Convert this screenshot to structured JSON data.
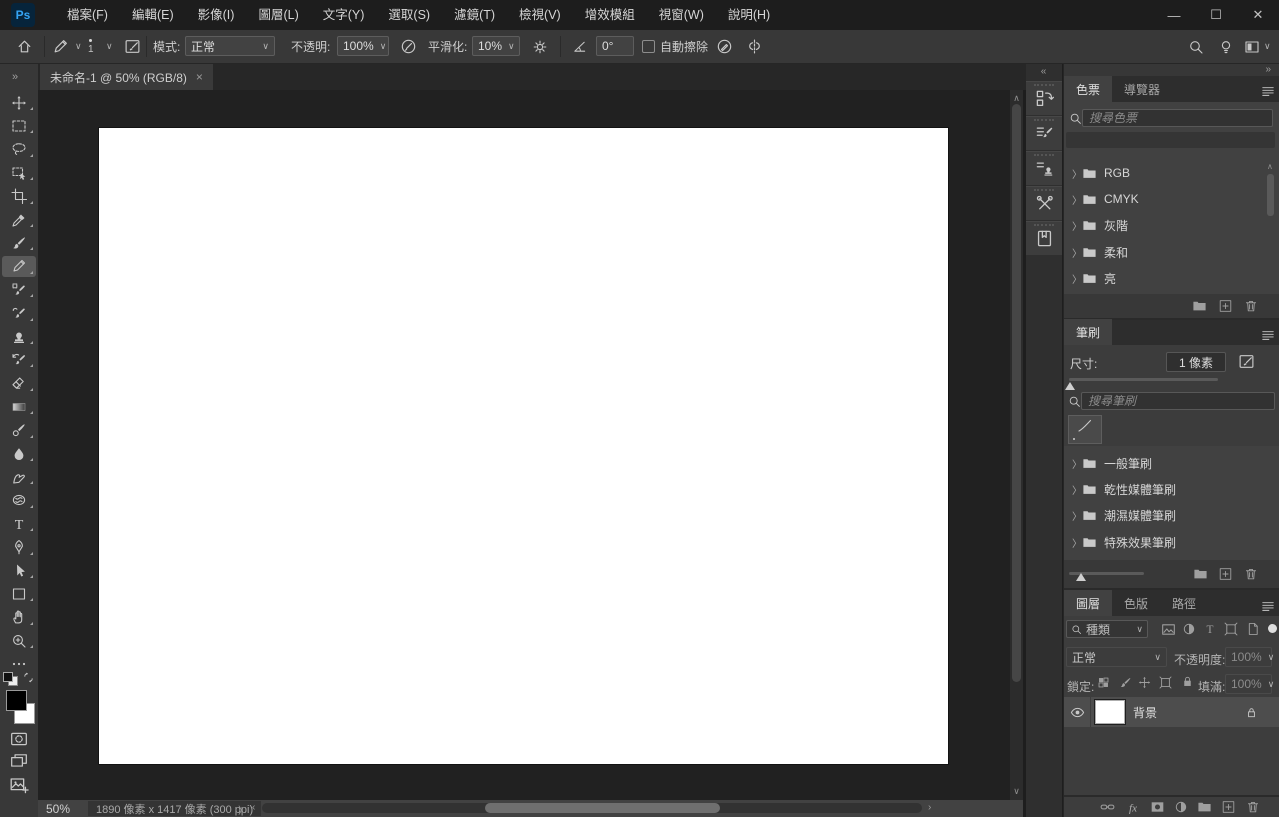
{
  "colors": {
    "accent_blue": "#35a4f4",
    "logo_bg": "#06243b",
    "canvas": "#ffffff"
  },
  "window": {
    "logo_text": "Ps"
  },
  "menu_bar": {
    "items": [
      "檔案(F)",
      "編輯(E)",
      "影像(I)",
      "圖層(L)",
      "文字(Y)",
      "選取(S)",
      "濾鏡(T)",
      "檢視(V)",
      "增效模組",
      "視窗(W)",
      "說明(H)"
    ]
  },
  "options_bar": {
    "brush_size_indicator": "1",
    "mode_label": "模式:",
    "mode_value": "正常",
    "opacity_label": "不透明:",
    "opacity_value": "100%",
    "smoothing_label": "平滑化:",
    "smoothing_value": "10%",
    "angle_value": "0°",
    "auto_erase_label": "自動擦除"
  },
  "document_tab": {
    "title": "未命名-1 @ 50% (RGB/8)",
    "close_glyph": "×"
  },
  "toolbar": {
    "expand_glyph": "»",
    "tools": [
      {
        "name": "move-tool",
        "icon": "move"
      },
      {
        "name": "marquee-tool",
        "icon": "marquee"
      },
      {
        "name": "lasso-tool",
        "icon": "lasso"
      },
      {
        "name": "object-selection-tool",
        "icon": "objsel"
      },
      {
        "name": "crop-tool",
        "icon": "crop"
      },
      {
        "name": "eyedropper-tool",
        "icon": "eyedropper"
      },
      {
        "name": "brush-tool",
        "icon": "brush"
      },
      {
        "name": "pencil-tool",
        "icon": "pencil",
        "selected": true
      },
      {
        "name": "color-replacement-tool",
        "icon": "colorreplace"
      },
      {
        "name": "art-history-brush-tool",
        "icon": "arthistory"
      },
      {
        "name": "clone-stamp-tool",
        "icon": "stamp"
      },
      {
        "name": "history-brush-tool",
        "icon": "historybrush"
      },
      {
        "name": "eraser-tool",
        "icon": "eraser"
      },
      {
        "name": "gradient-tool",
        "icon": "gradient"
      },
      {
        "name": "mixer-brush-tool",
        "icon": "mixerbrush"
      },
      {
        "name": "blur-tool",
        "icon": "blur"
      },
      {
        "name": "smudge-tool",
        "icon": "smudge"
      },
      {
        "name": "sponge-tool",
        "icon": "sponge"
      },
      {
        "name": "type-tool",
        "icon": "type"
      },
      {
        "name": "pen-tool",
        "icon": "pen"
      },
      {
        "name": "path-selection-tool",
        "icon": "pathsel"
      },
      {
        "name": "rectangle-tool",
        "icon": "rect"
      },
      {
        "name": "hand-tool",
        "icon": "hand"
      },
      {
        "name": "zoom-tool",
        "icon": "zoom"
      },
      {
        "name": "more-tools",
        "icon": "dots"
      }
    ]
  },
  "right_dock": {
    "collapse_glyph": "«",
    "panels": [
      {
        "name": "history-panel-icon",
        "icon": "historyPanel"
      },
      {
        "name": "brush-settings-panel-icon",
        "icon": "brushsettings"
      },
      {
        "name": "clone-source-panel-icon",
        "icon": "clonesource"
      },
      {
        "name": "tool-presets-panel-icon",
        "icon": "toolpresets"
      },
      {
        "name": "libraries-panel-icon",
        "icon": "libraries"
      }
    ]
  },
  "panel_header": {
    "collapse_glyph": "»"
  },
  "swatches_panel": {
    "tabs": [
      {
        "label": "色票",
        "active": true
      },
      {
        "label": "導覽器",
        "active": false
      }
    ],
    "search_placeholder": "搜尋色票",
    "groups": [
      "RGB",
      "CMYK",
      "灰階",
      "柔和",
      "亮"
    ]
  },
  "brushes_panel": {
    "tab": "筆刷",
    "size_label": "尺寸:",
    "size_value": "1 像素",
    "search_placeholder": "搜尋筆刷",
    "groups": [
      "一般筆刷",
      "乾性媒體筆刷",
      "潮濕媒體筆刷",
      "特殊效果筆刷"
    ]
  },
  "layers_panel": {
    "tabs": [
      {
        "label": "圖層",
        "active": true
      },
      {
        "label": "色版",
        "active": false
      },
      {
        "label": "路徑",
        "active": false
      }
    ],
    "filter_label": "種類",
    "blend_mode": "正常",
    "opacity_label": "不透明度:",
    "opacity_value": "100%",
    "lock_label": "鎖定:",
    "fill_label": "填滿:",
    "fill_value": "100%",
    "layers": [
      {
        "name": "背景",
        "visible": true,
        "locked": true
      }
    ]
  },
  "status_bar": {
    "zoom": "50%",
    "dimensions": "1890 像素 x 1417 像素 (300 ppi)"
  }
}
